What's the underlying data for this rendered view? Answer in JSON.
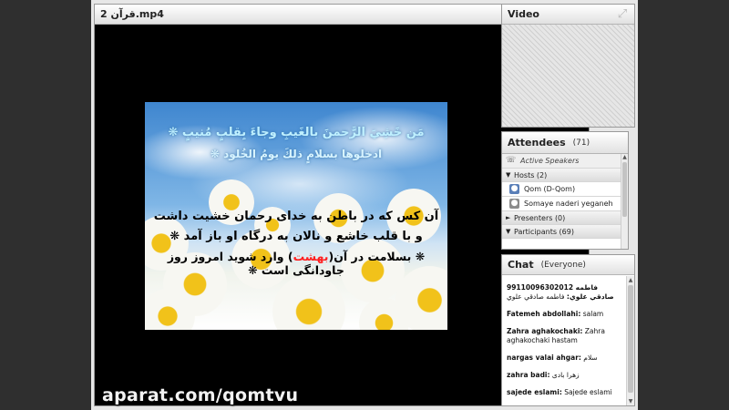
{
  "share": {
    "title": "قرآن 2.mp4"
  },
  "slide": {
    "line1": "مَن خَشِيَ الرَّحمنَ بالغَيبِ وجاءَ بِقلبٍ مُنيبٍ ❋",
    "line2": "ادخلوها بسلامٍ ذلكَ يومُ الخُلود ❋",
    "line3": "آن کس که در باطن به خدای رحمان خشیت داشت",
    "line4": "و با قلب خاشع و نالان به درگاه او باز آمد ❋",
    "line5_pre": "❋ بسلامت در آن(",
    "line5_highlight": "بهشت",
    "line5_post": ") وارد شوید امروز روز جاودانگی است ❋"
  },
  "watermark": "aparat.com/qomtvu",
  "video": {
    "title": "Video"
  },
  "attendees": {
    "title": "Attendees",
    "count": "(71)",
    "active_speakers": "Active Speakers",
    "hosts_label": "Hosts (2)",
    "hosts": [
      {
        "name": "Qom (D-Qom)"
      },
      {
        "name": "Somaye naderi yeganeh"
      }
    ],
    "presenters_label": "Presenters (0)",
    "participants_label": "Participants (69)"
  },
  "chat": {
    "title": "Chat",
    "scope": "(Everyone)",
    "messages": [
      {
        "sender": "99110096302012 فاطمه صادقي علوي:",
        "text": "فاطمه صادقي علوي"
      },
      {
        "sender": "Fatemeh abdollahi:",
        "text": "salam"
      },
      {
        "sender": "Zahra aghakochaki:",
        "text": "Zahra aghakochaki hastam"
      },
      {
        "sender": "nargas valai ahgar:",
        "text": "سلام"
      },
      {
        "sender": "zahra badi:",
        "text": "زهرا بادی"
      },
      {
        "sender": "sajede eslami:",
        "text": "Sajede eslami"
      }
    ]
  },
  "colors": {
    "background": "#2f2f2f",
    "panel": "#e7e7e7",
    "highlight_red": "#ff1e1e"
  }
}
